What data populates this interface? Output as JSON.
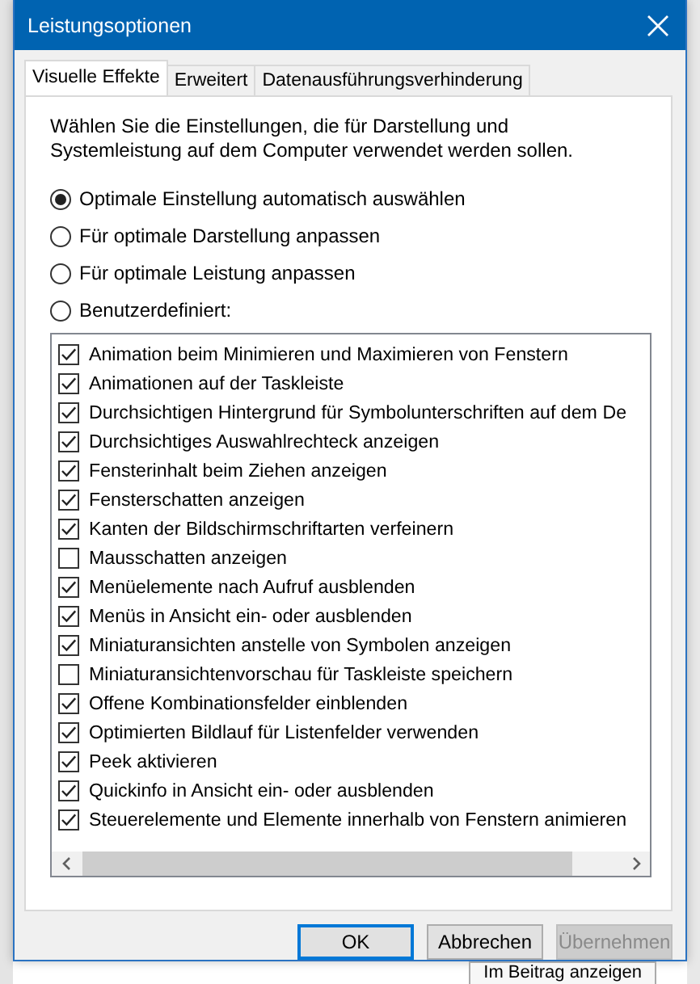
{
  "window": {
    "title": "Leistungsoptionen"
  },
  "tabs": [
    {
      "label": "Visuelle Effekte",
      "selected": true
    },
    {
      "label": "Erweitert",
      "selected": false
    },
    {
      "label": "Datenausführungsverhinderung",
      "selected": false
    }
  ],
  "intro": "Wählen Sie die Einstellungen, die für Darstellung und Systemleistung auf dem Computer verwendet werden sollen.",
  "radios": [
    {
      "label": "Optimale Einstellung automatisch auswählen",
      "selected": true
    },
    {
      "label": "Für optimale Darstellung anpassen",
      "selected": false
    },
    {
      "label": "Für optimale Leistung anpassen",
      "selected": false
    },
    {
      "label": "Benutzerdefiniert:",
      "selected": false
    }
  ],
  "effects": [
    {
      "label": "Animation beim Minimieren und Maximieren von Fenstern",
      "checked": true
    },
    {
      "label": "Animationen auf der Taskleiste",
      "checked": true
    },
    {
      "label": "Durchsichtigen Hintergrund für Symbolunterschriften auf dem De",
      "checked": true
    },
    {
      "label": "Durchsichtiges Auswahlrechteck anzeigen",
      "checked": true
    },
    {
      "label": "Fensterinhalt beim Ziehen anzeigen",
      "checked": true
    },
    {
      "label": "Fensterschatten anzeigen",
      "checked": true
    },
    {
      "label": "Kanten der Bildschirmschriftarten verfeinern",
      "checked": true
    },
    {
      "label": "Mausschatten anzeigen",
      "checked": false
    },
    {
      "label": "Menüelemente nach Aufruf ausblenden",
      "checked": true
    },
    {
      "label": "Menüs in Ansicht ein- oder ausblenden",
      "checked": true
    },
    {
      "label": "Miniaturansichten anstelle von Symbolen anzeigen",
      "checked": true
    },
    {
      "label": "Miniaturansichtenvorschau für Taskleiste speichern",
      "checked": false
    },
    {
      "label": "Offene Kombinationsfelder einblenden",
      "checked": true
    },
    {
      "label": "Optimierten Bildlauf für Listenfelder verwenden",
      "checked": true
    },
    {
      "label": "Peek aktivieren",
      "checked": true
    },
    {
      "label": "Quickinfo in Ansicht ein- oder ausblenden",
      "checked": true
    },
    {
      "label": "Steuerelemente und Elemente innerhalb von Fenstern animieren",
      "checked": true
    }
  ],
  "buttons": [
    {
      "label": "OK",
      "kind": "default"
    },
    {
      "label": "Abbrechen",
      "kind": "normal"
    },
    {
      "label": "Übernehmen",
      "kind": "disabled"
    }
  ],
  "background": {
    "button": "Im Beitrag anzeigen"
  }
}
